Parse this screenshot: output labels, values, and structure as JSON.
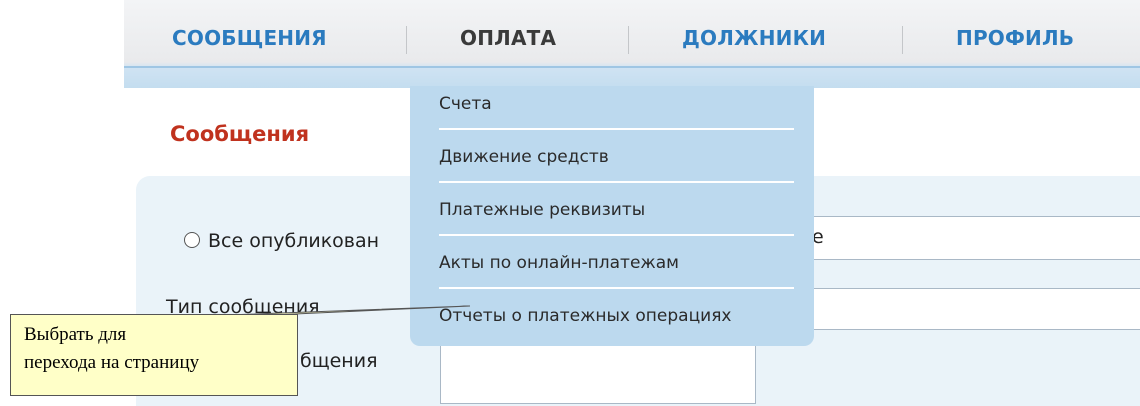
{
  "nav": {
    "items": [
      {
        "label": "СООБЩЕНИЯ"
      },
      {
        "label": "ОПЛАТА"
      },
      {
        "label": "ДОЛЖНИКИ"
      },
      {
        "label": "ПРОФИЛЬ"
      }
    ],
    "active": "ОПЛАТА"
  },
  "main": {
    "title": "Сообщения",
    "filters": {
      "radio_label": "Все опубликован",
      "field1_value": "е",
      "type_label": "Тип сообщения",
      "type2_label": "бщения"
    }
  },
  "dropdown": {
    "items": [
      {
        "label": "Счета"
      },
      {
        "label": "Движение средств"
      },
      {
        "label": "Платежные реквизиты"
      },
      {
        "label": "Акты по онлайн-платежам"
      },
      {
        "label": "Отчеты о платежных операциях"
      }
    ]
  },
  "callout": {
    "line1": "Выбрать для",
    "line2": "перехода на страницу"
  },
  "colors": {
    "nav_link": "#2b7bbf",
    "nav_active": "#3a3a3a",
    "section_title": "#c0321e",
    "dropdown_bg": "#bcd9ee",
    "callout_bg": "#ffffc8"
  }
}
